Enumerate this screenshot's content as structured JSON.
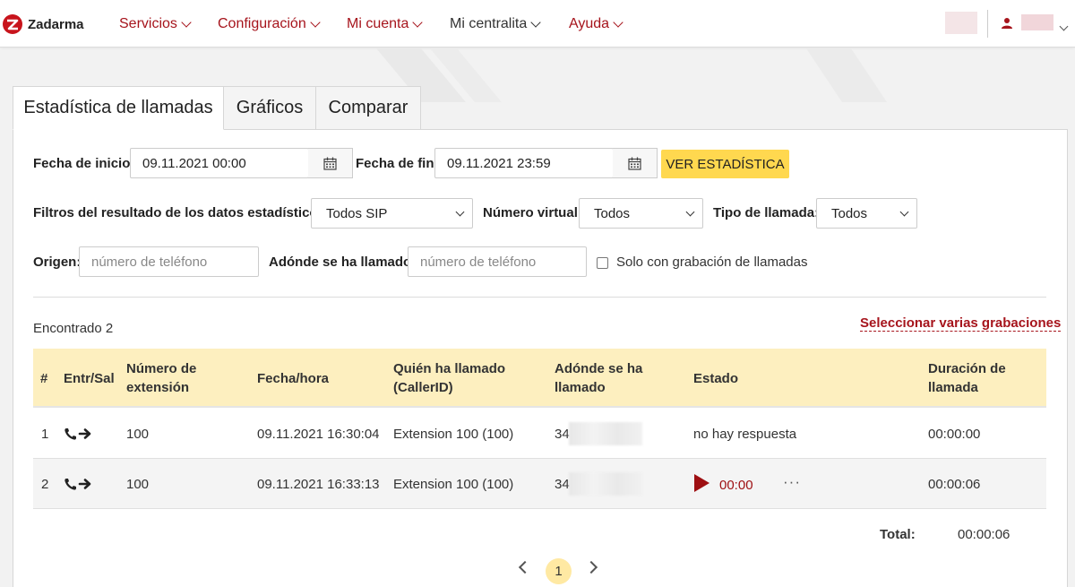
{
  "header": {
    "logo": "Zadarma",
    "menu": [
      {
        "label": "Servicios"
      },
      {
        "label": "Configuración"
      },
      {
        "label": "Mi cuenta"
      },
      {
        "label": "Mi centralita"
      },
      {
        "label": "Ayuda"
      }
    ]
  },
  "tabs": [
    {
      "label": "Estadística de llamadas",
      "active": true
    },
    {
      "label": "Gráficos"
    },
    {
      "label": "Comparar"
    }
  ],
  "filters": {
    "start_label": "Fecha de inicio:",
    "start_value": "09.11.2021 00:00",
    "end_label": "Fecha de fin:",
    "end_value": "09.11.2021 23:59",
    "submit_label": "VER ESTADÍSTICA",
    "result_filters_label": "Filtros del resultado de los datos estadísticos:",
    "sip_value": "Todos SIP",
    "virtual_label": "Número virtual:",
    "virtual_value": "Todos",
    "call_type_label": "Tipo de llamada:",
    "call_type_value": "Todos",
    "origin_label": "Origen:",
    "origin_placeholder": "número de teléfono",
    "dest_label": "Adónde se ha llamado:",
    "dest_placeholder": "número de teléfono",
    "recording_only_label": "Solo con grabación de llamadas"
  },
  "results": {
    "found_label": "Encontrado 2",
    "select_multiple_label": "Seleccionar varias grabaciones"
  },
  "table": {
    "headers": {
      "num": "#",
      "direction": "Entr/Sal",
      "extension": [
        "Número de",
        "extensión"
      ],
      "datetime": "Fecha/hora",
      "caller": [
        "Quién ha llamado",
        "(CallerID)"
      ],
      "destination": [
        "Adónde se ha",
        "llamado"
      ],
      "status": "Estado",
      "duration": [
        "Duración de",
        "llamada"
      ]
    },
    "rows": [
      {
        "num": "1",
        "direction_icon": "outgoing-call-icon",
        "extension": "100",
        "datetime": "09.11.2021 16:30:04",
        "caller": "Extension 100 (100)",
        "destination": "34",
        "status": "no hay respuesta",
        "duration": "00:00:00"
      },
      {
        "num": "2",
        "direction_icon": "outgoing-call-icon",
        "extension": "100",
        "datetime": "09.11.2021 16:33:13",
        "caller": "Extension 100 (100)",
        "destination": "34",
        "recording_time": "00:00",
        "more": "···",
        "duration": "00:00:06"
      }
    ],
    "total_label": "Total:",
    "total_value": "00:00:06"
  },
  "pagination": {
    "current": "1"
  },
  "colors": {
    "brand": "#a6141c",
    "accent": "#ffd84f",
    "table_header": "#fdefbf"
  }
}
